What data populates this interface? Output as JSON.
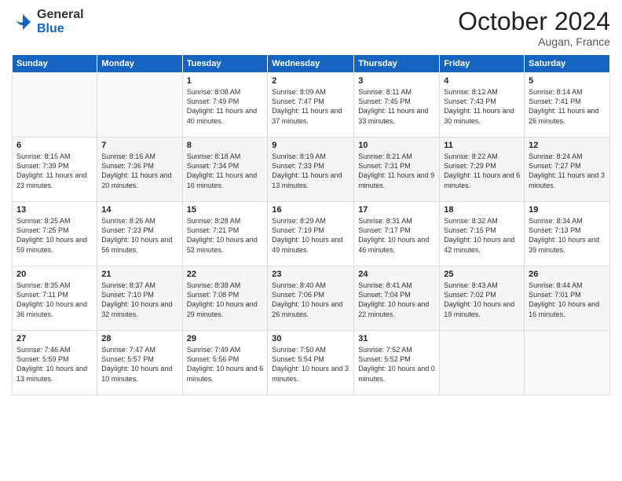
{
  "logo": {
    "general": "General",
    "blue": "Blue"
  },
  "title": "October 2024",
  "location": "Augan, France",
  "days_header": [
    "Sunday",
    "Monday",
    "Tuesday",
    "Wednesday",
    "Thursday",
    "Friday",
    "Saturday"
  ],
  "weeks": [
    [
      {
        "day": "",
        "sunrise": "",
        "sunset": "",
        "daylight": ""
      },
      {
        "day": "",
        "sunrise": "",
        "sunset": "",
        "daylight": ""
      },
      {
        "day": "1",
        "sunrise": "Sunrise: 8:08 AM",
        "sunset": "Sunset: 7:49 PM",
        "daylight": "Daylight: 11 hours and 40 minutes."
      },
      {
        "day": "2",
        "sunrise": "Sunrise: 8:09 AM",
        "sunset": "Sunset: 7:47 PM",
        "daylight": "Daylight: 11 hours and 37 minutes."
      },
      {
        "day": "3",
        "sunrise": "Sunrise: 8:11 AM",
        "sunset": "Sunset: 7:45 PM",
        "daylight": "Daylight: 11 hours and 33 minutes."
      },
      {
        "day": "4",
        "sunrise": "Sunrise: 8:12 AM",
        "sunset": "Sunset: 7:43 PM",
        "daylight": "Daylight: 11 hours and 30 minutes."
      },
      {
        "day": "5",
        "sunrise": "Sunrise: 8:14 AM",
        "sunset": "Sunset: 7:41 PM",
        "daylight": "Daylight: 11 hours and 26 minutes."
      }
    ],
    [
      {
        "day": "6",
        "sunrise": "Sunrise: 8:15 AM",
        "sunset": "Sunset: 7:39 PM",
        "daylight": "Daylight: 11 hours and 23 minutes."
      },
      {
        "day": "7",
        "sunrise": "Sunrise: 8:16 AM",
        "sunset": "Sunset: 7:36 PM",
        "daylight": "Daylight: 11 hours and 20 minutes."
      },
      {
        "day": "8",
        "sunrise": "Sunrise: 8:18 AM",
        "sunset": "Sunset: 7:34 PM",
        "daylight": "Daylight: 11 hours and 16 minutes."
      },
      {
        "day": "9",
        "sunrise": "Sunrise: 8:19 AM",
        "sunset": "Sunset: 7:33 PM",
        "daylight": "Daylight: 11 hours and 13 minutes."
      },
      {
        "day": "10",
        "sunrise": "Sunrise: 8:21 AM",
        "sunset": "Sunset: 7:31 PM",
        "daylight": "Daylight: 11 hours and 9 minutes."
      },
      {
        "day": "11",
        "sunrise": "Sunrise: 8:22 AM",
        "sunset": "Sunset: 7:29 PM",
        "daylight": "Daylight: 11 hours and 6 minutes."
      },
      {
        "day": "12",
        "sunrise": "Sunrise: 8:24 AM",
        "sunset": "Sunset: 7:27 PM",
        "daylight": "Daylight: 11 hours and 3 minutes."
      }
    ],
    [
      {
        "day": "13",
        "sunrise": "Sunrise: 8:25 AM",
        "sunset": "Sunset: 7:25 PM",
        "daylight": "Daylight: 10 hours and 59 minutes."
      },
      {
        "day": "14",
        "sunrise": "Sunrise: 8:26 AM",
        "sunset": "Sunset: 7:23 PM",
        "daylight": "Daylight: 10 hours and 56 minutes."
      },
      {
        "day": "15",
        "sunrise": "Sunrise: 8:28 AM",
        "sunset": "Sunset: 7:21 PM",
        "daylight": "Daylight: 10 hours and 52 minutes."
      },
      {
        "day": "16",
        "sunrise": "Sunrise: 8:29 AM",
        "sunset": "Sunset: 7:19 PM",
        "daylight": "Daylight: 10 hours and 49 minutes."
      },
      {
        "day": "17",
        "sunrise": "Sunrise: 8:31 AM",
        "sunset": "Sunset: 7:17 PM",
        "daylight": "Daylight: 10 hours and 46 minutes."
      },
      {
        "day": "18",
        "sunrise": "Sunrise: 8:32 AM",
        "sunset": "Sunset: 7:15 PM",
        "daylight": "Daylight: 10 hours and 42 minutes."
      },
      {
        "day": "19",
        "sunrise": "Sunrise: 8:34 AM",
        "sunset": "Sunset: 7:13 PM",
        "daylight": "Daylight: 10 hours and 39 minutes."
      }
    ],
    [
      {
        "day": "20",
        "sunrise": "Sunrise: 8:35 AM",
        "sunset": "Sunset: 7:11 PM",
        "daylight": "Daylight: 10 hours and 36 minutes."
      },
      {
        "day": "21",
        "sunrise": "Sunrise: 8:37 AM",
        "sunset": "Sunset: 7:10 PM",
        "daylight": "Daylight: 10 hours and 32 minutes."
      },
      {
        "day": "22",
        "sunrise": "Sunrise: 8:38 AM",
        "sunset": "Sunset: 7:08 PM",
        "daylight": "Daylight: 10 hours and 29 minutes."
      },
      {
        "day": "23",
        "sunrise": "Sunrise: 8:40 AM",
        "sunset": "Sunset: 7:06 PM",
        "daylight": "Daylight: 10 hours and 26 minutes."
      },
      {
        "day": "24",
        "sunrise": "Sunrise: 8:41 AM",
        "sunset": "Sunset: 7:04 PM",
        "daylight": "Daylight: 10 hours and 22 minutes."
      },
      {
        "day": "25",
        "sunrise": "Sunrise: 8:43 AM",
        "sunset": "Sunset: 7:02 PM",
        "daylight": "Daylight: 10 hours and 19 minutes."
      },
      {
        "day": "26",
        "sunrise": "Sunrise: 8:44 AM",
        "sunset": "Sunset: 7:01 PM",
        "daylight": "Daylight: 10 hours and 16 minutes."
      }
    ],
    [
      {
        "day": "27",
        "sunrise": "Sunrise: 7:46 AM",
        "sunset": "Sunset: 5:59 PM",
        "daylight": "Daylight: 10 hours and 13 minutes."
      },
      {
        "day": "28",
        "sunrise": "Sunrise: 7:47 AM",
        "sunset": "Sunset: 5:57 PM",
        "daylight": "Daylight: 10 hours and 10 minutes."
      },
      {
        "day": "29",
        "sunrise": "Sunrise: 7:49 AM",
        "sunset": "Sunset: 5:56 PM",
        "daylight": "Daylight: 10 hours and 6 minutes."
      },
      {
        "day": "30",
        "sunrise": "Sunrise: 7:50 AM",
        "sunset": "Sunset: 5:54 PM",
        "daylight": "Daylight: 10 hours and 3 minutes."
      },
      {
        "day": "31",
        "sunrise": "Sunrise: 7:52 AM",
        "sunset": "Sunset: 5:52 PM",
        "daylight": "Daylight: 10 hours and 0 minutes."
      },
      {
        "day": "",
        "sunrise": "",
        "sunset": "",
        "daylight": ""
      },
      {
        "day": "",
        "sunrise": "",
        "sunset": "",
        "daylight": ""
      }
    ]
  ]
}
